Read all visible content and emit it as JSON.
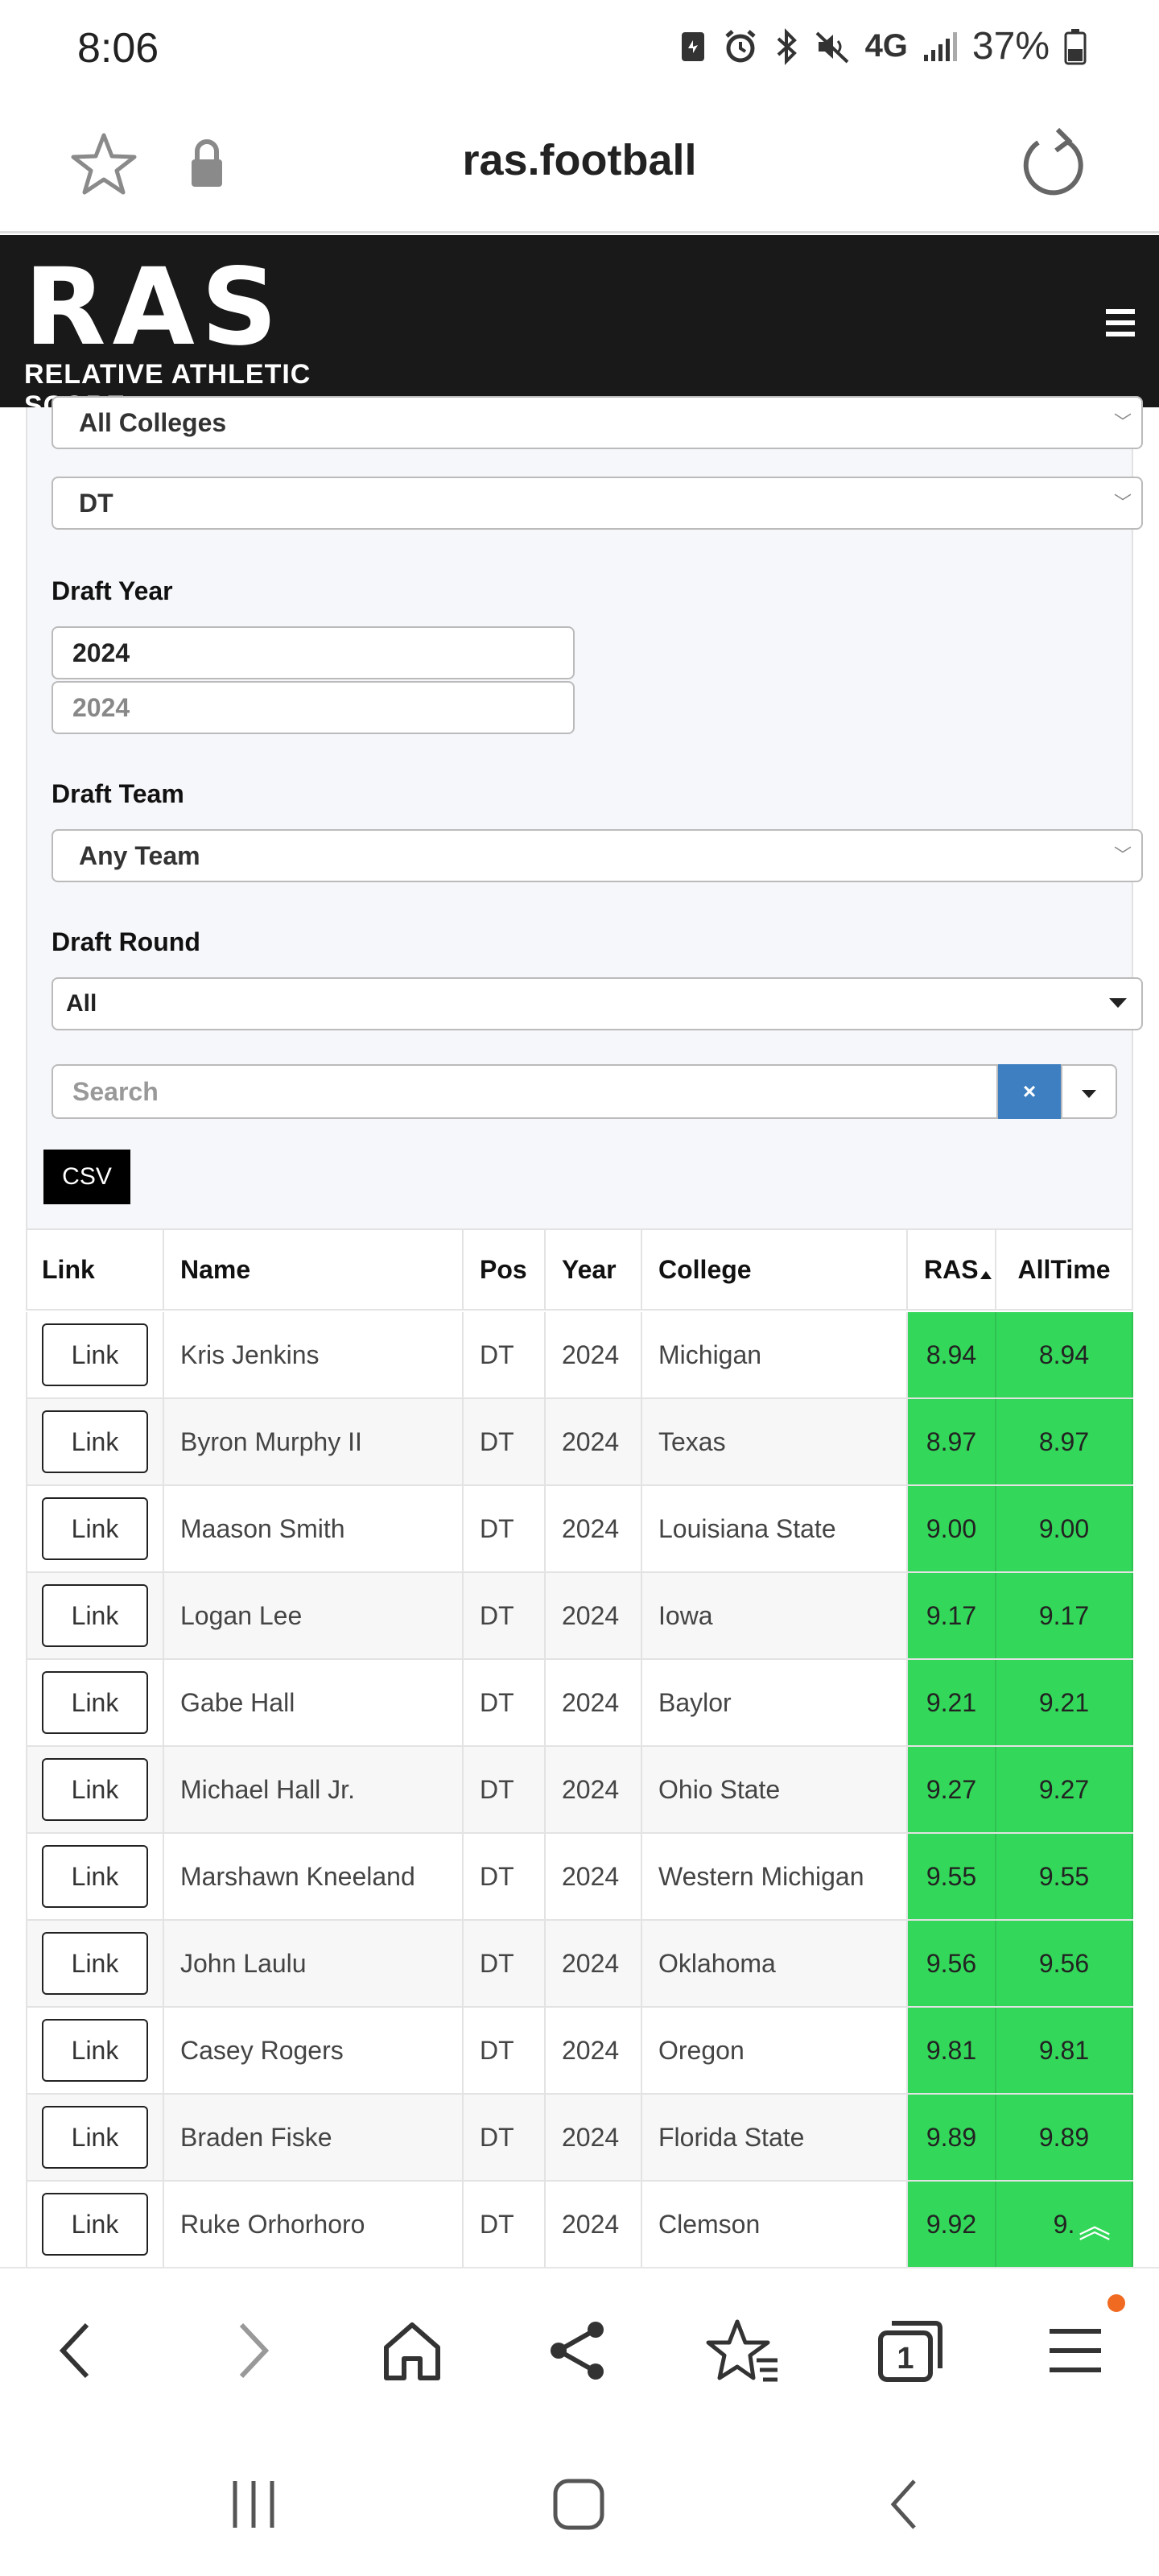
{
  "status_bar": {
    "time": "8:06",
    "network": "4G",
    "battery": "37%"
  },
  "browser": {
    "domain": "ras.football"
  },
  "site": {
    "logo_text": "RAS",
    "logo_subtitle": "RELATIVE ATHLETIC SCORE"
  },
  "filters": {
    "college_select": "All Colleges",
    "position_select": "DT",
    "draft_year_label": "Draft Year",
    "year_from": "2024",
    "year_to_placeholder": "2024",
    "draft_team_label": "Draft Team",
    "draft_team_select": "Any Team",
    "draft_round_label": "Draft Round",
    "draft_round_select": "All",
    "search_placeholder": "Search",
    "clear_label": "×",
    "csv_label": "CSV"
  },
  "table": {
    "headers": [
      "Link",
      "Name",
      "Pos",
      "Year",
      "College",
      "RAS",
      "AllTime"
    ],
    "rows": [
      {
        "link": "Link",
        "name": "Kris Jenkins",
        "pos": "DT",
        "year": "2024",
        "college": "Michigan",
        "ras": "8.94",
        "alltime": "8.94"
      },
      {
        "link": "Link",
        "name": "Byron Murphy II",
        "pos": "DT",
        "year": "2024",
        "college": "Texas",
        "ras": "8.97",
        "alltime": "8.97"
      },
      {
        "link": "Link",
        "name": "Maason Smith",
        "pos": "DT",
        "year": "2024",
        "college": "Louisiana State",
        "ras": "9.00",
        "alltime": "9.00"
      },
      {
        "link": "Link",
        "name": "Logan Lee",
        "pos": "DT",
        "year": "2024",
        "college": "Iowa",
        "ras": "9.17",
        "alltime": "9.17"
      },
      {
        "link": "Link",
        "name": "Gabe Hall",
        "pos": "DT",
        "year": "2024",
        "college": "Baylor",
        "ras": "9.21",
        "alltime": "9.21"
      },
      {
        "link": "Link",
        "name": "Michael Hall Jr.",
        "pos": "DT",
        "year": "2024",
        "college": "Ohio State",
        "ras": "9.27",
        "alltime": "9.27"
      },
      {
        "link": "Link",
        "name": "Marshawn Kneeland",
        "pos": "DT",
        "year": "2024",
        "college": "Western Michigan",
        "ras": "9.55",
        "alltime": "9.55"
      },
      {
        "link": "Link",
        "name": "John Laulu",
        "pos": "DT",
        "year": "2024",
        "college": "Oklahoma",
        "ras": "9.56",
        "alltime": "9.56"
      },
      {
        "link": "Link",
        "name": "Casey Rogers",
        "pos": "DT",
        "year": "2024",
        "college": "Oregon",
        "ras": "9.81",
        "alltime": "9.81"
      },
      {
        "link": "Link",
        "name": "Braden Fiske",
        "pos": "DT",
        "year": "2024",
        "college": "Florida State",
        "ras": "9.89",
        "alltime": "9.89"
      },
      {
        "link": "Link",
        "name": "Ruke Orhorhoro",
        "pos": "DT",
        "year": "2024",
        "college": "Clemson",
        "ras": "9.92",
        "alltime": "9."
      }
    ]
  },
  "toolbar": {
    "tab_count": "1"
  },
  "colors": {
    "score_green": "#33d759",
    "clear_blue": "#3d7fc1",
    "header_dark": "#191919",
    "notification": "#f06a22"
  },
  "icons": [
    "star-icon",
    "lock-icon",
    "reload-icon",
    "hamburger-icon",
    "back-icon",
    "forward-icon",
    "home-icon",
    "share-icon",
    "bookmarks-icon",
    "tabs-icon",
    "menu-icon",
    "scroll-top-icon"
  ]
}
